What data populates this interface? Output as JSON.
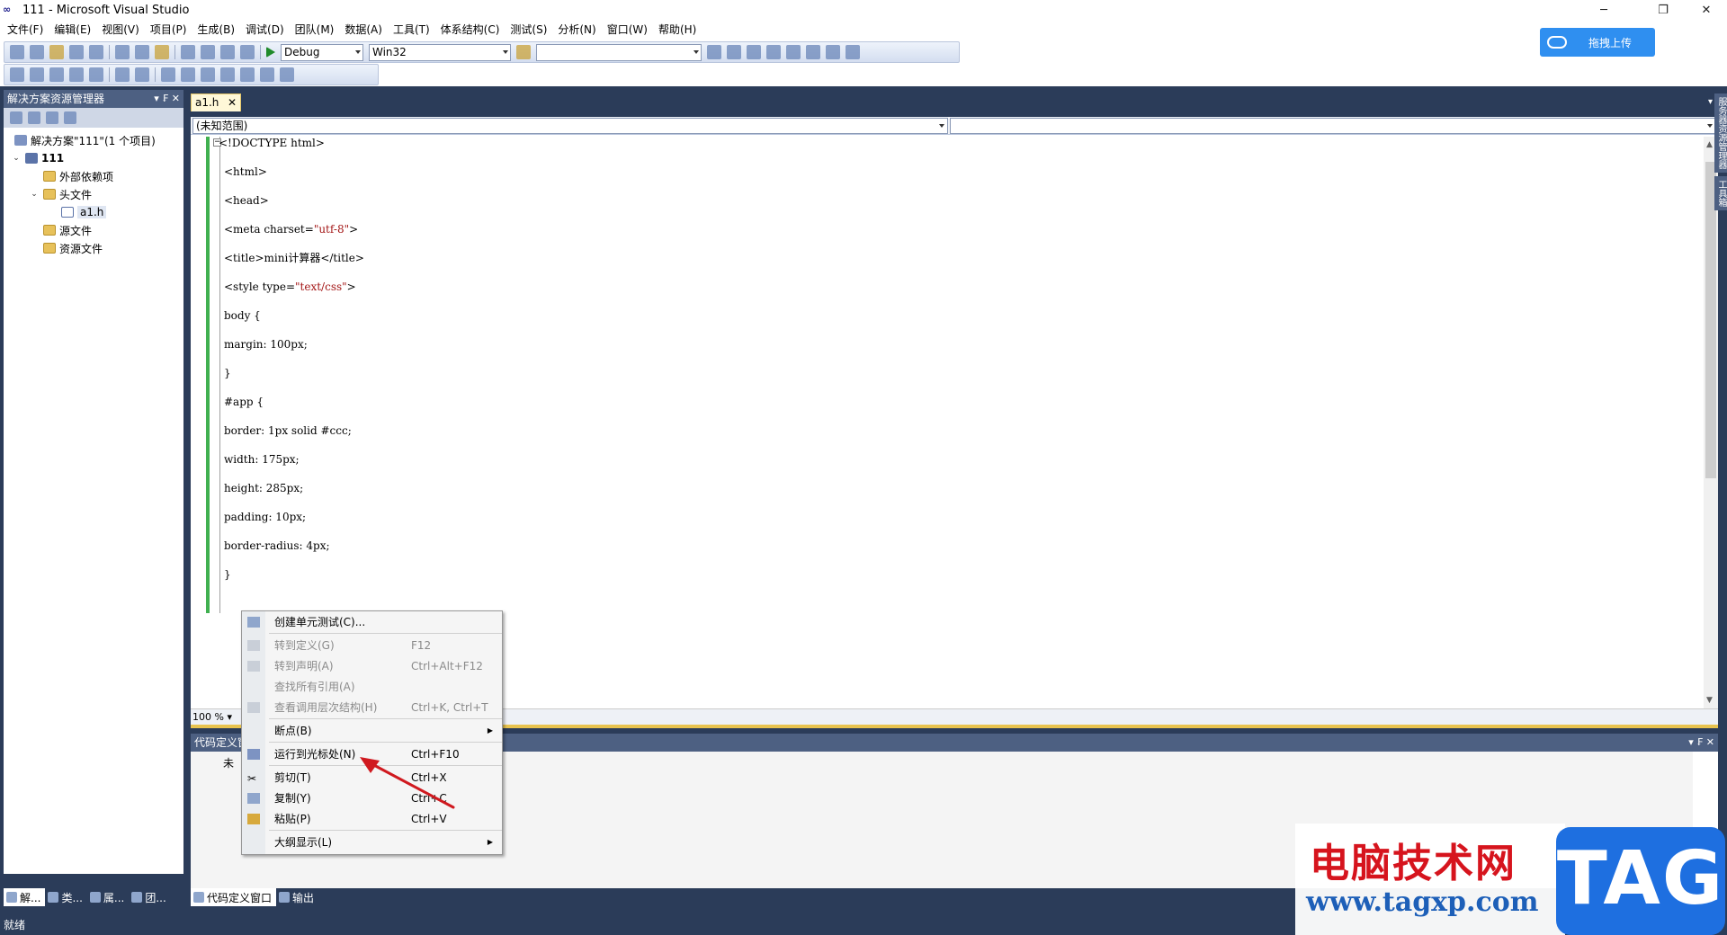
{
  "window": {
    "title": "111 - Microsoft Visual Studio",
    "logo": "∞"
  },
  "menu": [
    "文件(F)",
    "编辑(E)",
    "视图(V)",
    "项目(P)",
    "生成(B)",
    "调试(D)",
    "团队(M)",
    "数据(A)",
    "工具(T)",
    "体系结构(C)",
    "测试(S)",
    "分析(N)",
    "窗口(W)",
    "帮助(H)"
  ],
  "toolbar": {
    "config": "Debug",
    "platform": "Win32",
    "find_value": ""
  },
  "upload_button": "拖拽上传",
  "solution_explorer": {
    "title": "解决方案资源管理器",
    "panel_buttons": "▾ ₣ ✕",
    "items": [
      {
        "label": "解决方案\"111\"(1 个项目)"
      },
      {
        "label": "111"
      },
      {
        "label": "外部依赖项"
      },
      {
        "label": "头文件"
      },
      {
        "label": "a1.h"
      },
      {
        "label": "源文件"
      },
      {
        "label": "资源文件"
      }
    ]
  },
  "left_bottom_tabs": [
    "解...",
    "类...",
    "属...",
    "团..."
  ],
  "editor": {
    "tab": "a1.h",
    "scope": "(未知范围)",
    "zoom": "100 %",
    "lines": [
      {
        "text": "<!DOCTYPE html>"
      },
      {
        "text": "<html>"
      },
      {
        "text": "<head>"
      },
      {
        "pre": "<meta charset=",
        "str": "\"utf-8\"",
        "post": ">"
      },
      {
        "text": "<title>mini计算器</title>"
      },
      {
        "pre": "<style type=",
        "str": "\"text/css\"",
        "post": ">"
      },
      {
        "text": "body {"
      },
      {
        "text": "margin: 100px;"
      },
      {
        "text": "}"
      },
      {
        "text": "#app {"
      },
      {
        "text": "border: 1px solid #ccc;"
      },
      {
        "text": "width: 175px;"
      },
      {
        "text": "height: 285px;"
      },
      {
        "text": "padding: 10px;"
      },
      {
        "text": "border-radius: 4px;"
      },
      {
        "text": "}"
      }
    ]
  },
  "definition_window": {
    "title": "代码定义窗口",
    "content": "未"
  },
  "bottom_tabs": [
    "代码定义窗口",
    "输出"
  ],
  "right_strip": [
    "服务器资源管理器",
    "工具箱"
  ],
  "status": "就绪",
  "context_menu": [
    {
      "label": "创建单元测试(C)...",
      "key": "",
      "disabled": false,
      "icon": "unit-test-icon"
    },
    {
      "sep": true
    },
    {
      "label": "转到定义(G)",
      "key": "F12",
      "disabled": true,
      "icon": "goto-definition-icon"
    },
    {
      "label": "转到声明(A)",
      "key": "Ctrl+Alt+F12",
      "disabled": true,
      "icon": "goto-declaration-icon"
    },
    {
      "label": "查找所有引用(A)",
      "key": "",
      "disabled": true,
      "icon": ""
    },
    {
      "label": "查看调用层次结构(H)",
      "key": "Ctrl+K, Ctrl+T",
      "disabled": true,
      "icon": "call-hierarchy-icon"
    },
    {
      "sep": true
    },
    {
      "label": "断点(B)",
      "key": "",
      "disabled": false,
      "submenu": true,
      "icon": ""
    },
    {
      "sep": true
    },
    {
      "label": "运行到光标处(N)",
      "key": "Ctrl+F10",
      "disabled": false,
      "icon": "run-to-cursor-icon"
    },
    {
      "sep": true
    },
    {
      "label": "剪切(T)",
      "key": "Ctrl+X",
      "disabled": false,
      "icon": "cut-icon"
    },
    {
      "label": "复制(Y)",
      "key": "Ctrl+C",
      "disabled": false,
      "icon": "copy-icon"
    },
    {
      "label": "粘贴(P)",
      "key": "Ctrl+V",
      "disabled": false,
      "icon": "paste-icon"
    },
    {
      "sep": true
    },
    {
      "label": "大纲显示(L)",
      "key": "",
      "disabled": false,
      "submenu": true,
      "icon": ""
    }
  ],
  "watermark": {
    "site_name": "电脑技术网",
    "url": "www.tagxp.com",
    "tag": "TAG"
  },
  "colors": {
    "chrome": "#2b3c59",
    "panel_title": "#4d6082",
    "string": "#a31515",
    "gutter_changed": "#40b050",
    "annotation_arrow": "#d0191f"
  }
}
